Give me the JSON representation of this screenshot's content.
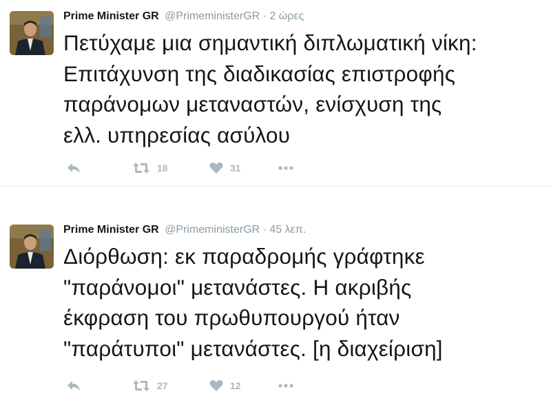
{
  "tweets": [
    {
      "author_name": "Prime Minister GR",
      "handle": "@PrimeministerGR",
      "separator": "·",
      "time": "2 ώρες",
      "text": "Πετύχαμε μια σημαντική διπλωματική νίκη:\nΕπιτάχυνση της διαδικασίας επιστροφής\nπαράνομων μεταναστών, ενίσχυση της\nελλ. υπηρεσίας ασύλου",
      "retweet_count": "18",
      "like_count": "31",
      "icons": {
        "reply": "reply-icon",
        "retweet": "retweet-icon",
        "like": "heart-icon",
        "more": "more-icon"
      }
    },
    {
      "author_name": "Prime Minister GR",
      "handle": "@PrimeministerGR",
      "separator": "·",
      "time": "45 λεπ.",
      "text": "Διόρθωση: εκ παραδρομής γράφτηκε\n\"παράνομοι\" μετανάστες. Η ακριβής\nέκφραση του πρωθυπουργού ήταν\n\"παράτυποι\" μετανάστες. [η διαχείριση]",
      "retweet_count": "27",
      "like_count": "12",
      "icons": {
        "reply": "reply-icon",
        "retweet": "retweet-icon",
        "like": "heart-icon",
        "more": "more-icon"
      }
    }
  ],
  "colors": {
    "name": "#14171a",
    "meta": "#8899a6",
    "action_icon": "#aab8c2",
    "divider": "#e1e8ed"
  }
}
